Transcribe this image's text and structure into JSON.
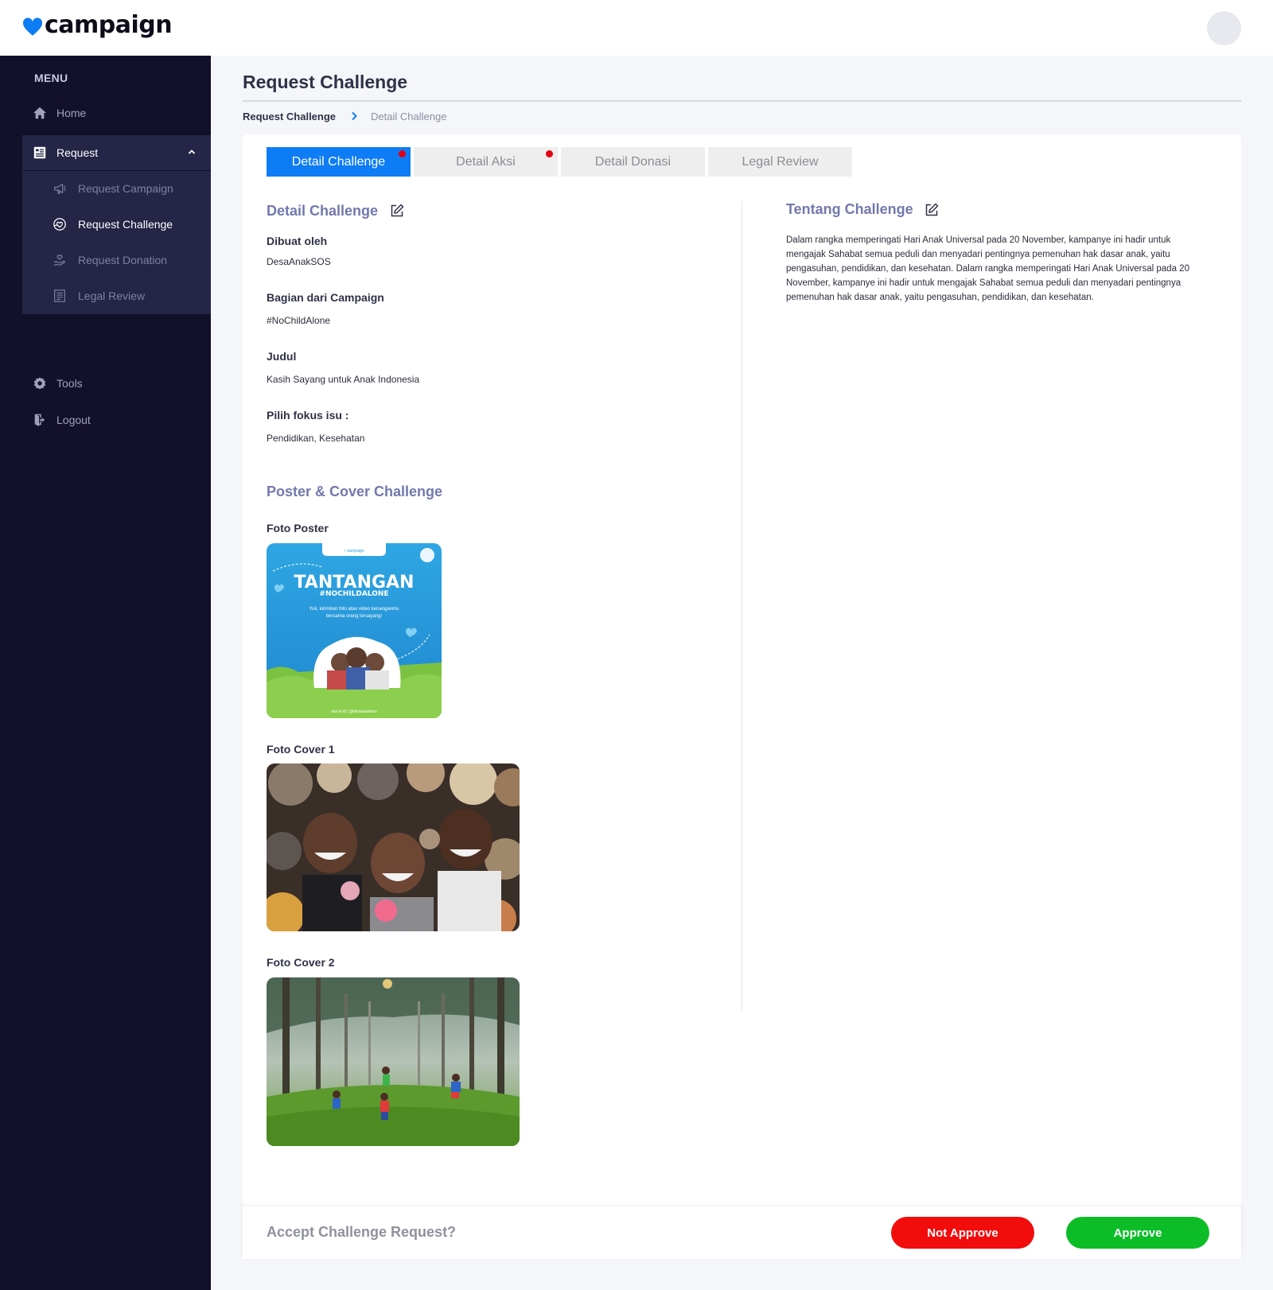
{
  "brand": {
    "name": "campaign",
    "color": "#0e7cf4"
  },
  "sidebar": {
    "menu_title": "MENU",
    "items": [
      {
        "label": "Home",
        "icon": "home-icon"
      },
      {
        "label": "Request",
        "icon": "request-icon",
        "expanded": true
      },
      {
        "label": "Tools",
        "icon": "gear-icon"
      },
      {
        "label": "Logout",
        "icon": "logout-icon"
      }
    ],
    "sub_items": [
      {
        "label": "Request Campaign",
        "icon": "megaphone-icon"
      },
      {
        "label": "Request Challenge",
        "icon": "hand-heart-icon",
        "active": true
      },
      {
        "label": "Request Donation",
        "icon": "donation-icon"
      },
      {
        "label": "Legal Review",
        "icon": "document-icon"
      }
    ]
  },
  "page": {
    "title": "Request Challenge",
    "breadcrumb": [
      "Request Challenge",
      "Detail Challenge"
    ]
  },
  "tabs": [
    {
      "label": "Detail Challenge",
      "active": true,
      "has_dot": true
    },
    {
      "label": "Detail Aksi",
      "active": false,
      "has_dot": true
    },
    {
      "label": "Detail Donasi",
      "active": false,
      "has_dot": false
    },
    {
      "label": "Legal Review",
      "active": false,
      "has_dot": false
    }
  ],
  "detail": {
    "heading": "Detail Challenge",
    "fields": [
      {
        "label": "Dibuat oleh",
        "value": "DesaAnakSOS"
      },
      {
        "label": "Bagian dari Campaign",
        "value": "#NoChildAlone"
      },
      {
        "label": "Judul",
        "value": "Kasih Sayang untuk Anak Indonesia"
      },
      {
        "label": "Pilih fokus isu :",
        "value": "Pendidikan, Kesehatan"
      }
    ]
  },
  "about": {
    "heading": "Tentang Challenge",
    "text": "Dalam rangka memperingati Hari Anak Universal pada 20 November, kampanye ini hadir untuk mengajak Sahabat semua peduli dan menyadari pentingnya pemenuhan hak dasar anak, yaitu pengasuhan, pendidikan, dan kesehatan. Dalam rangka memperingati Hari Anak Universal pada 20 November, kampanye ini hadir untuk mengajak Sahabat semua peduli dan menyadari pentingnya pemenuhan hak dasar anak, yaitu pengasuhan, pendidikan, dan kesehatan."
  },
  "media": {
    "heading": "Poster & Cover Challenge",
    "poster_label": "Foto Poster",
    "poster": {
      "title": "TANTANGAN",
      "hashtag": "#NOCHILDALONE",
      "subtitle_1": "Yuk, kirimkan foto atau video kenanganmu",
      "subtitle_2": "bersama orang tersayang!",
      "footer": "sos.or.id  |  @desaanaksos",
      "header": "• campaign",
      "bg_color": "#2aa1e0",
      "grass_color": "#7cc242"
    },
    "cover1_label": "Foto Cover 1",
    "cover2_label": "Foto Cover 2"
  },
  "actions": {
    "question": "Accept Challenge Request?",
    "reject_label": "Not Approve",
    "approve_label": "Approve",
    "reject_color": "#f20c0c",
    "approve_color": "#0dbd28"
  }
}
